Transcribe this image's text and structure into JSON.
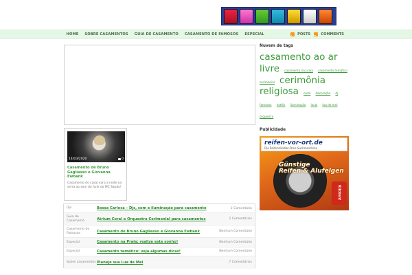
{
  "top_banner": {
    "icons": [
      "game-tile-icon",
      "game-tile-icon",
      "game-tile-icon",
      "game-tile-icon",
      "game-tile-icon",
      "game-tile-icon",
      "game-tile-icon"
    ]
  },
  "nav": {
    "items": [
      "HOME",
      "SOBRE CASAMENTOS",
      "GUIA DE CASAMENTO",
      "CASAMENTO DE FAMOSOS",
      "ESPECIAL"
    ],
    "posts_feed": "POSTS",
    "comments_feed": "COMMENTS"
  },
  "post_card": {
    "date": "14/03/2020",
    "comments": "0",
    "title": "Casamento de Bruno Gagliasso e Giovanna Ewbank",
    "excerpt": "Casamento do casal vara a noite na serra ao som do funk do MC Sapão!"
  },
  "sidebar": {
    "tags_title": "Nuvem de tags",
    "tags": [
      {
        "text": "casamento ao ar livre",
        "size": "xl"
      },
      {
        "text": "casamento na praia",
        "size": "sm"
      },
      {
        "text": "casamento temático",
        "size": "sm"
      },
      {
        "text": "cerimonial",
        "size": "sm"
      },
      {
        "text": "cerimônia religiosa",
        "size": "xl"
      },
      {
        "text": "coral",
        "size": "sm"
      },
      {
        "text": "decoração",
        "size": "sm"
      },
      {
        "text": "dj",
        "size": "sm"
      },
      {
        "text": "famosos",
        "size": "sm"
      },
      {
        "text": "hotéis",
        "size": "sm"
      },
      {
        "text": "iluminação",
        "size": "sm"
      },
      {
        "text": "local",
        "size": "sm"
      },
      {
        "text": "lua de mel",
        "size": "sm"
      },
      {
        "text": "orquestra",
        "size": "sm"
      }
    ],
    "ads_title": "Publicidade",
    "ad": {
      "brand": "reifen-vor-ort.de",
      "sub": "Die Reifenhändler-Preis-Suchmaschine",
      "promo_line1": "Günstige",
      "promo_line2": "Reifen & Alufelgen",
      "cta": "Klicken!"
    }
  },
  "recent_posts": [
    {
      "category": "Djs",
      "title": "Bossa Carioca – Djs, som e iluminação para casamento",
      "count": "1 Comentário",
      "tall": false
    },
    {
      "category": "Guia de Casamento",
      "title": "Atrium Coral e Orquestra Cerimonial para casamentos",
      "count": "2 Comentários",
      "tall": true
    },
    {
      "category": "Casamento de Famosos",
      "title": "Casamento de Bruno Gagliasso e Giovanna Ewbank",
      "count": "Nenhum Comentário",
      "tall": true
    },
    {
      "category": "Especial",
      "title": "Casamento na Praia: realize este sonho!",
      "count": "Nenhum Comentário",
      "tall": false
    },
    {
      "category": "Especial",
      "title": "Casamento temático: veja algumas dicas!",
      "count": "Nenhum Comentário",
      "tall": false
    },
    {
      "category": "Sobre casamentos",
      "title": "Planeje sua Lua de Mel",
      "count": "7 Comentários",
      "tall": true
    }
  ]
}
